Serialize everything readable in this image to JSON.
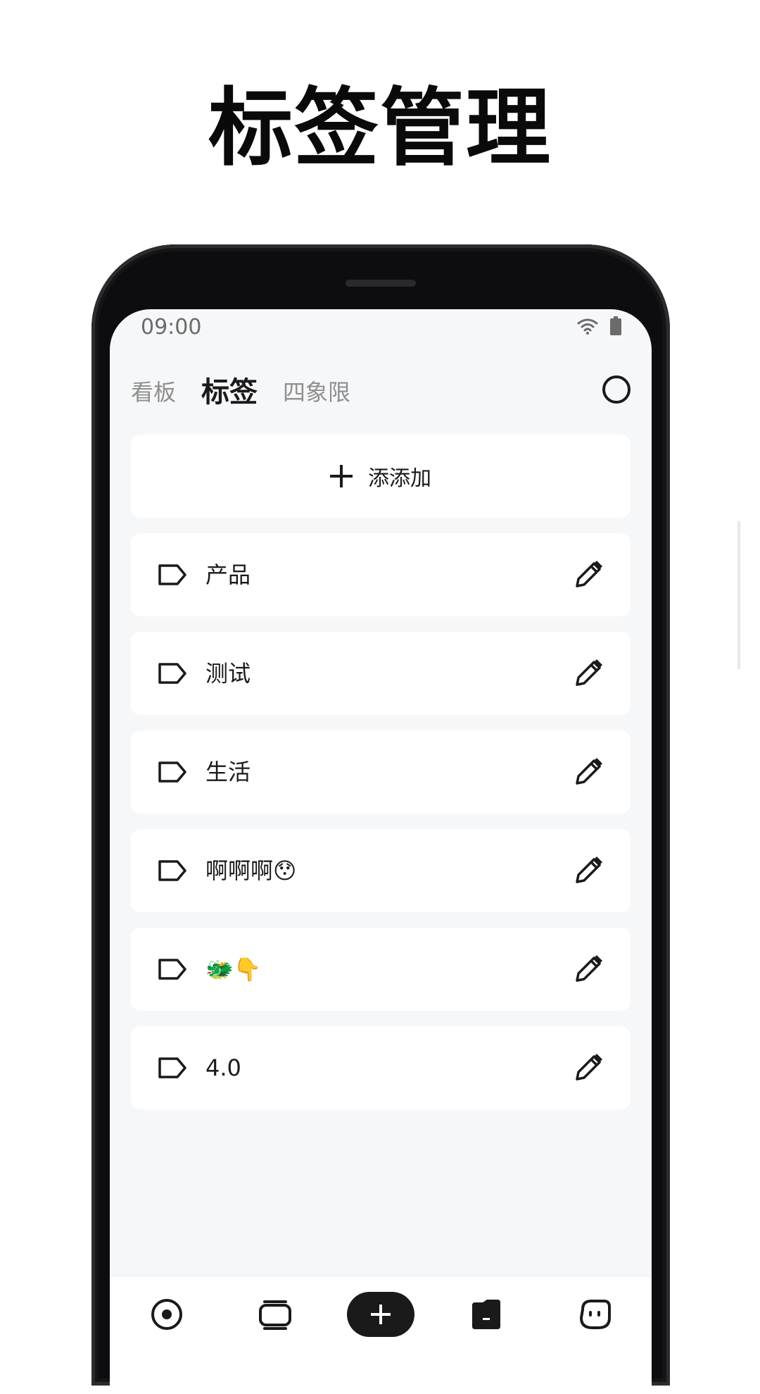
{
  "headline": "标签管理",
  "status_bar": {
    "time": "09:00"
  },
  "tabs": [
    {
      "label": "看板",
      "active": false
    },
    {
      "label": "标签",
      "active": true
    },
    {
      "label": "四象限",
      "active": false
    }
  ],
  "add_button": {
    "label": "添添加",
    "icon": "plus-icon"
  },
  "tags": [
    {
      "label": "产品",
      "icon": "tag-icon",
      "action_icon": "pencil-icon"
    },
    {
      "label": "测试",
      "icon": "tag-icon",
      "action_icon": "pencil-icon"
    },
    {
      "label": "生活",
      "icon": "tag-icon",
      "action_icon": "pencil-icon"
    },
    {
      "label": "啊啊啊😯",
      "icon": "tag-icon",
      "action_icon": "pencil-icon"
    },
    {
      "label": "🐲👇",
      "icon": "tag-icon",
      "action_icon": "pencil-icon"
    },
    {
      "label": "4.0",
      "icon": "tag-icon",
      "action_icon": "pencil-icon"
    }
  ],
  "bottom_nav": {
    "items": [
      "target-icon",
      "cards-icon",
      "plus-icon",
      "folder-icon",
      "face-icon"
    ]
  },
  "colors": {
    "screen_bg": "#f6f7f9",
    "card_bg": "#ffffff",
    "text_primary": "#1a1a1a",
    "text_muted": "#8f8f8f",
    "frame": "#0d0d0f"
  }
}
